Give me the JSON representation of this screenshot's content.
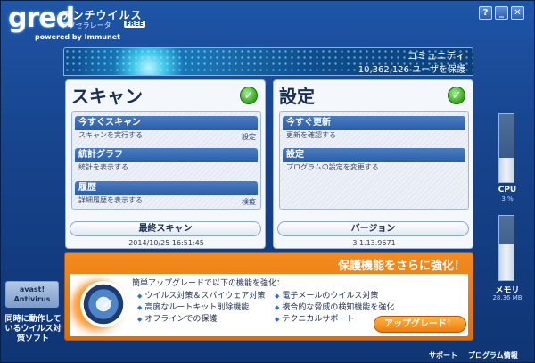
{
  "app": {
    "logo": "gred",
    "name_line1": "アンチウイルス",
    "name_line2": "アクセラレータ",
    "free_badge": "FREE",
    "powered": "powered by Immunet"
  },
  "titlebar": {
    "help": "?",
    "minimize": "_",
    "close": "✕"
  },
  "banner": {
    "community": "コミュニティ",
    "users": "10,362,126 ユーザを保護"
  },
  "scan": {
    "title": "スキャン",
    "items": [
      {
        "title": "今すぐスキャン",
        "desc": "スキャンを実行する",
        "link": "設定"
      },
      {
        "title": "統計グラフ",
        "desc": "統計を表示する",
        "link": ""
      },
      {
        "title": "履歴",
        "desc": "詳細履歴を表示する",
        "link": "検疫"
      }
    ],
    "button": "最終スキャン",
    "button_sub": "2014/10/25 16:51:45"
  },
  "settings": {
    "title": "設定",
    "items": [
      {
        "title": "今すぐ更新",
        "desc": "更新を確認する"
      },
      {
        "title": "設定",
        "desc": "プログラムの設定を変更する"
      }
    ],
    "button": "バージョン",
    "button_sub": "3.1.13.9671"
  },
  "upgrade": {
    "title": "保護機能をさらに強化！",
    "headline": "簡単アップグレードで以下の機能を強化：",
    "features_left": [
      "ウイルス対策＆スパイウェア対策",
      "高度なルートキット削除機能",
      "オフラインでの保護"
    ],
    "features_right": [
      "電子メールのウイルス対策",
      "複合的な脅威の検知機能を強化",
      "テクニカルサポート"
    ],
    "button": "アップグレード！"
  },
  "meters": {
    "cpu": {
      "label": "CPU",
      "value": "3 %",
      "level": 0.35
    },
    "memory": {
      "label": "メモリ",
      "value": "28.36 MB",
      "level": 0.55
    }
  },
  "sidebar": {
    "avast_line1": "avast!",
    "avast_line2": "Antivirus",
    "compat": "同時に動作しているウイルス対策ソフト"
  },
  "footer": {
    "support": "サポート",
    "info": "プログラム情報"
  }
}
